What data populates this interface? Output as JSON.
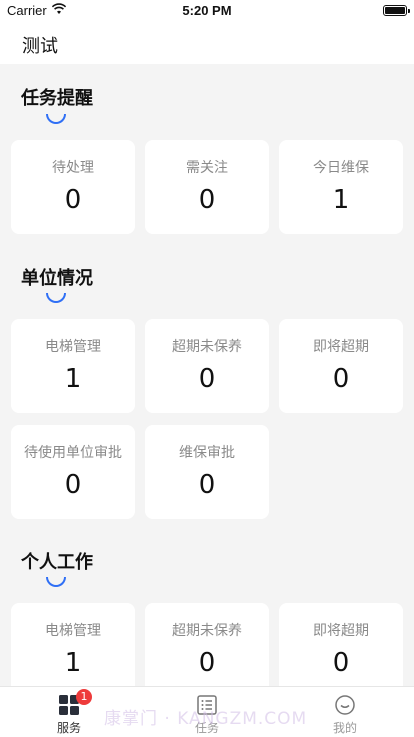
{
  "status": {
    "carrier": "Carrier",
    "time": "5:20 PM"
  },
  "nav": {
    "title": "测试"
  },
  "sections": [
    {
      "title": "任务提醒",
      "cards": [
        {
          "label": "待处理",
          "value": "0"
        },
        {
          "label": "需关注",
          "value": "0"
        },
        {
          "label": "今日维保",
          "value": "1"
        }
      ]
    },
    {
      "title": "单位情况",
      "cards": [
        {
          "label": "电梯管理",
          "value": "1"
        },
        {
          "label": "超期未保养",
          "value": "0"
        },
        {
          "label": "即将超期",
          "value": "0"
        },
        {
          "label": "待使用单位审批",
          "value": "0"
        },
        {
          "label": "维保审批",
          "value": "0"
        }
      ]
    },
    {
      "title": "个人工作",
      "cards": [
        {
          "label": "电梯管理",
          "value": "1"
        },
        {
          "label": "超期未保养",
          "value": "0"
        },
        {
          "label": "即将超期",
          "value": "0"
        }
      ]
    }
  ],
  "tabbar": {
    "tabs": [
      {
        "label": "服务",
        "icon": "grid-icon",
        "badge": "1",
        "active": true
      },
      {
        "label": "任务",
        "icon": "list-icon",
        "active": false
      },
      {
        "label": "我的",
        "icon": "smiley-icon",
        "active": false
      }
    ]
  },
  "watermark": "康掌门 · KANGZM.COM",
  "colors": {
    "accent": "#2f6ff5",
    "badge": "#ee3b3b",
    "background": "#f4f4f4"
  }
}
